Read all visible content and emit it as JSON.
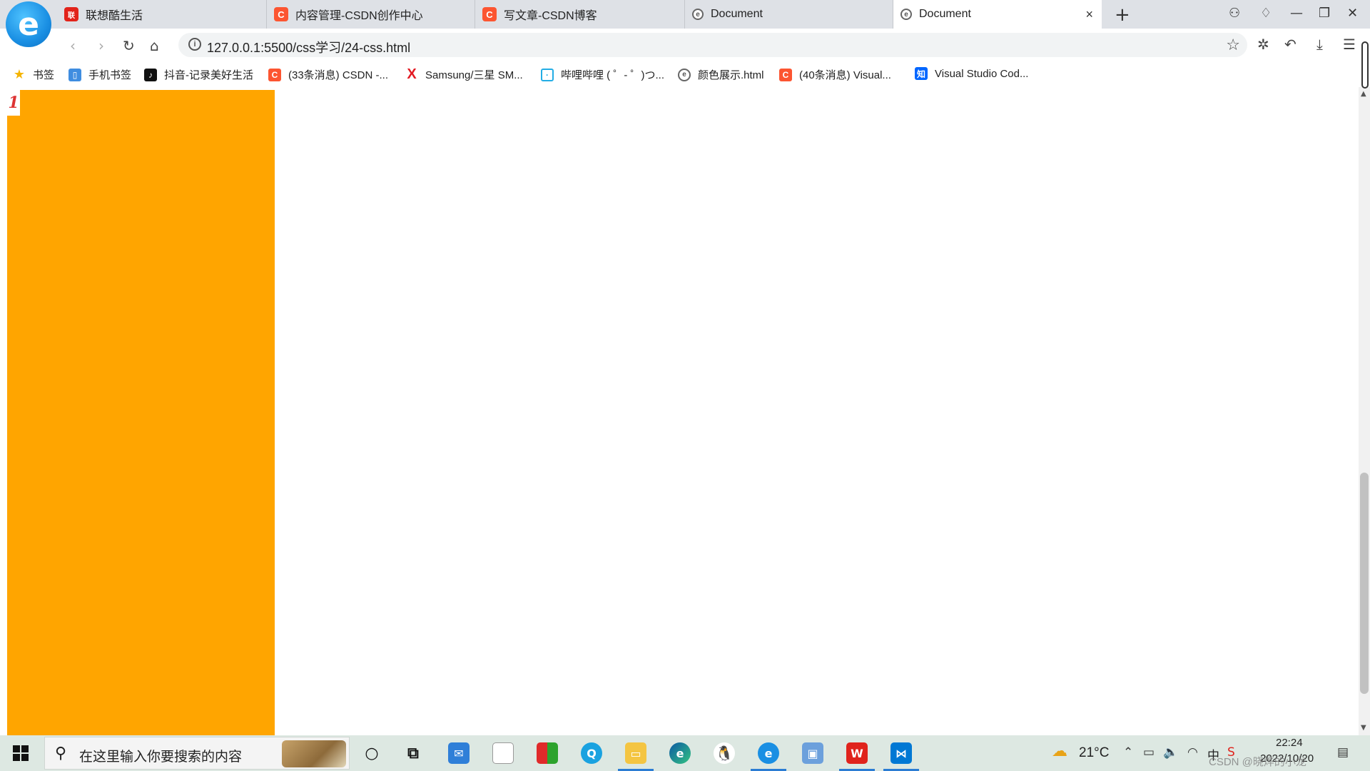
{
  "tabs": [
    {
      "label": "联想酷生活",
      "icon": "lenovo-icon"
    },
    {
      "label": "内容管理-CSDN创作中心",
      "icon": "csdn-icon"
    },
    {
      "label": "写文章-CSDN博客",
      "icon": "csdn-icon"
    },
    {
      "label": "Document",
      "icon": "document-icon"
    },
    {
      "label": "Document",
      "icon": "document-icon",
      "active": true
    }
  ],
  "tab_close_glyph": "×",
  "new_tab_glyph": "+",
  "address": {
    "url": "127.0.0.1:5500/css学习/24-css.html"
  },
  "bookmarks": [
    {
      "label": "书签",
      "icon": "star-icon"
    },
    {
      "label": "手机书签",
      "icon": "phone-bookmark-icon"
    },
    {
      "label": "抖音-记录美好生活",
      "icon": "douyin-icon"
    },
    {
      "label": "(33条消息) CSDN -...",
      "icon": "csdn-icon"
    },
    {
      "label": "Samsung/三星 SM...",
      "icon": "x-icon"
    },
    {
      "label": "哔哩哔哩 ( ゜- ゜)つ...",
      "icon": "bilibili-icon"
    },
    {
      "label": "颜色展示.html",
      "icon": "document-icon"
    },
    {
      "label": "(40条消息) Visual...",
      "icon": "csdn-icon"
    },
    {
      "label": "Visual Studio Cod...",
      "icon": "zhihu-icon"
    }
  ],
  "page": {
    "box_color": "#ffa500",
    "badge_text": "1"
  },
  "taskbar": {
    "search_placeholder": "在这里输入你要搜索的内容",
    "weather": "21°C",
    "time": "22:24",
    "date": "2022/10/20",
    "ime": "中",
    "watermark": "CSDN @晓烨的小龙"
  },
  "colors": {
    "accent": "#2b7cd3",
    "csdn": "#fc5531",
    "orange": "#ffa500"
  }
}
